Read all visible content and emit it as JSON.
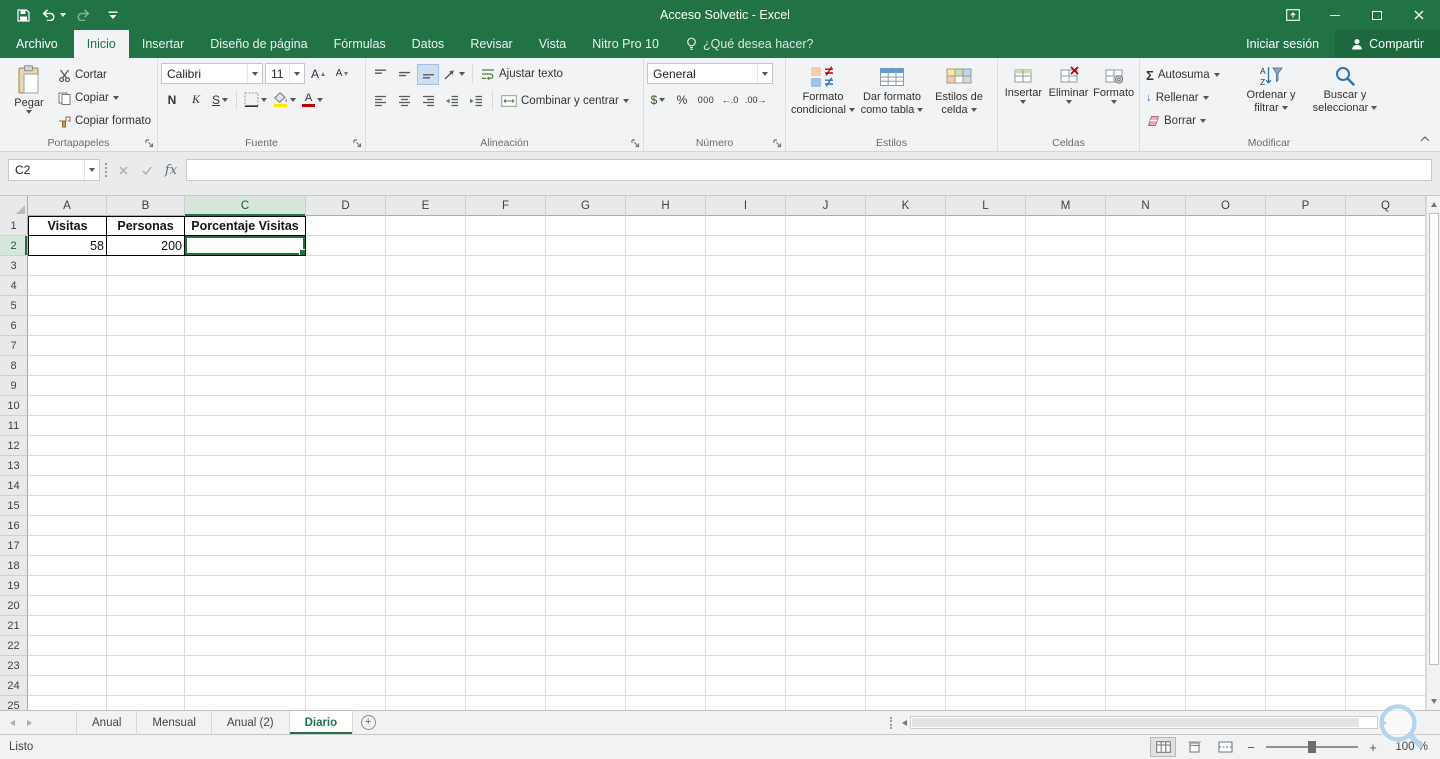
{
  "titlebar": {
    "title": "Acceso Solvetic - Excel"
  },
  "ribbon_tabs": {
    "file": "Archivo",
    "items": [
      "Inicio",
      "Insertar",
      "Diseño de página",
      "Fórmulas",
      "Datos",
      "Revisar",
      "Vista",
      "Nitro Pro 10"
    ],
    "active": "Inicio",
    "tell_me": "¿Qué desea hacer?",
    "sign_in": "Iniciar sesión",
    "share": "Compartir"
  },
  "ribbon": {
    "clipboard": {
      "title": "Portapapeles",
      "paste": "Pegar",
      "cut": "Cortar",
      "copy": "Copiar",
      "format_painter": "Copiar formato"
    },
    "font": {
      "title": "Fuente",
      "family": "Calibri",
      "size": "11"
    },
    "alignment": {
      "title": "Alineación",
      "wrap_text": "Ajustar texto",
      "merge_center": "Combinar y centrar"
    },
    "number": {
      "title": "Número",
      "format": "General"
    },
    "styles": {
      "title": "Estilos",
      "conditional": "Formato condicional",
      "format_table": "Dar formato como tabla",
      "cell_styles": "Estilos de celda"
    },
    "cells": {
      "title": "Celdas",
      "insert": "Insertar",
      "delete": "Eliminar",
      "format": "Formato"
    },
    "editing": {
      "title": "Modificar",
      "autosum": "Autosuma",
      "fill": "Rellenar",
      "clear": "Borrar",
      "sort_filter": "Ordenar y filtrar",
      "find_select": "Buscar y seleccionar"
    }
  },
  "icons": {
    "bold": "N",
    "italic": "K",
    "underline": "S",
    "font_letter": "A",
    "autosum": "Σ",
    "fill_down": "↓",
    "accounting": "$",
    "percent": "%",
    "comma_style": "000",
    "increase_decimal": "←.0",
    "decrease_decimal": ".00→",
    "fx": "fx",
    "new_sheet": "+",
    "zoom_out": "−",
    "zoom_in": "+"
  },
  "formula_bar": {
    "name_box": "C2",
    "formula": ""
  },
  "grid": {
    "columns": [
      "A",
      "B",
      "C",
      "D",
      "E",
      "F",
      "G",
      "H",
      "I",
      "J",
      "K",
      "L",
      "M",
      "N",
      "O",
      "P",
      "Q"
    ],
    "col_widths": {
      "A": 79,
      "B": 78,
      "C": 121,
      "default": 80
    },
    "row_count": 25,
    "selected_cell": "C2",
    "selected_column": "C",
    "selected_row": 2,
    "bordered_range": {
      "cols": [
        "A",
        "B",
        "C"
      ],
      "rows": [
        1,
        2
      ]
    },
    "cells": [
      {
        "ref": "A1",
        "text": "Visitas",
        "bold": true,
        "align": "center"
      },
      {
        "ref": "B1",
        "text": "Personas",
        "bold": true,
        "align": "center"
      },
      {
        "ref": "C1",
        "text": "Porcentaje Visitas",
        "bold": true,
        "align": "center"
      },
      {
        "ref": "A2",
        "text": "58",
        "align": "right"
      },
      {
        "ref": "B2",
        "text": "200",
        "align": "right"
      }
    ]
  },
  "sheet_bar": {
    "tabs": [
      "Anual",
      "Mensual",
      "Anual (2)",
      "Diario"
    ],
    "active": "Diario"
  },
  "status_bar": {
    "mode": "Listo",
    "zoom": "100 %"
  },
  "colors": {
    "accent": "#217346",
    "font_color_swatch": "#c00000",
    "fill_color_swatch": "#ffe600",
    "selection": "#217346"
  }
}
